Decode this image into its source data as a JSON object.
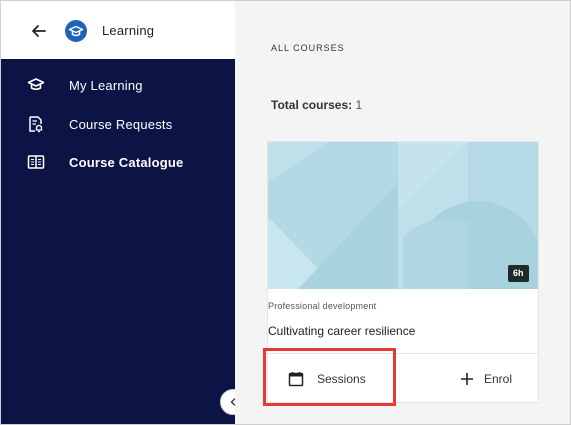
{
  "sidebar": {
    "title": "Learning",
    "items": [
      {
        "label": "My Learning",
        "icon": "graduation-cap-icon",
        "active": false
      },
      {
        "label": "Course Requests",
        "icon": "request-doc-icon",
        "active": false
      },
      {
        "label": "Course Catalogue",
        "icon": "catalogue-book-icon",
        "active": true
      }
    ]
  },
  "main": {
    "section_title": "ALL COURSES",
    "total_label": "Total courses:",
    "total_count": "1",
    "course": {
      "duration": "6h",
      "category": "Professional development",
      "title": "Cultivating career resilience",
      "sessions_label": "Sessions",
      "enrol_label": "Enrol"
    }
  },
  "colors": {
    "sidebar_bg": "#0c1445",
    "brand_blue": "#1f63b8",
    "highlight": "#e53935",
    "thumbnail": "#b9dde8"
  }
}
